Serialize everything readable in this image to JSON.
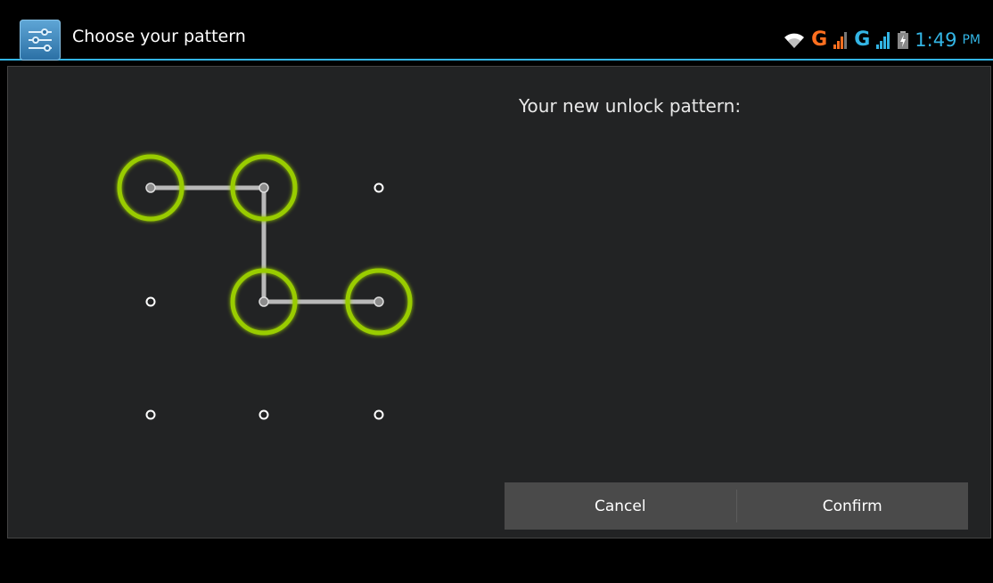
{
  "header": {
    "title": "Choose your pattern",
    "app_icon": "settings-sliders-icon",
    "accent_color": "#33b5e5"
  },
  "status_bar": {
    "wifi_icon": "wifi-icon",
    "network1": "G",
    "network1_color": "#ff6f1f",
    "network2": "G",
    "network2_color": "#33b5e5",
    "battery_icon": "battery-charging-icon",
    "time": "1:49",
    "ampm": "PM"
  },
  "main": {
    "heading": "Your new unlock pattern:",
    "pattern": {
      "grid": "3x3",
      "selected_sequence": [
        1,
        2,
        5,
        6
      ],
      "ring_color": "#99cc00"
    }
  },
  "buttons": {
    "cancel": "Cancel",
    "confirm": "Confirm"
  }
}
